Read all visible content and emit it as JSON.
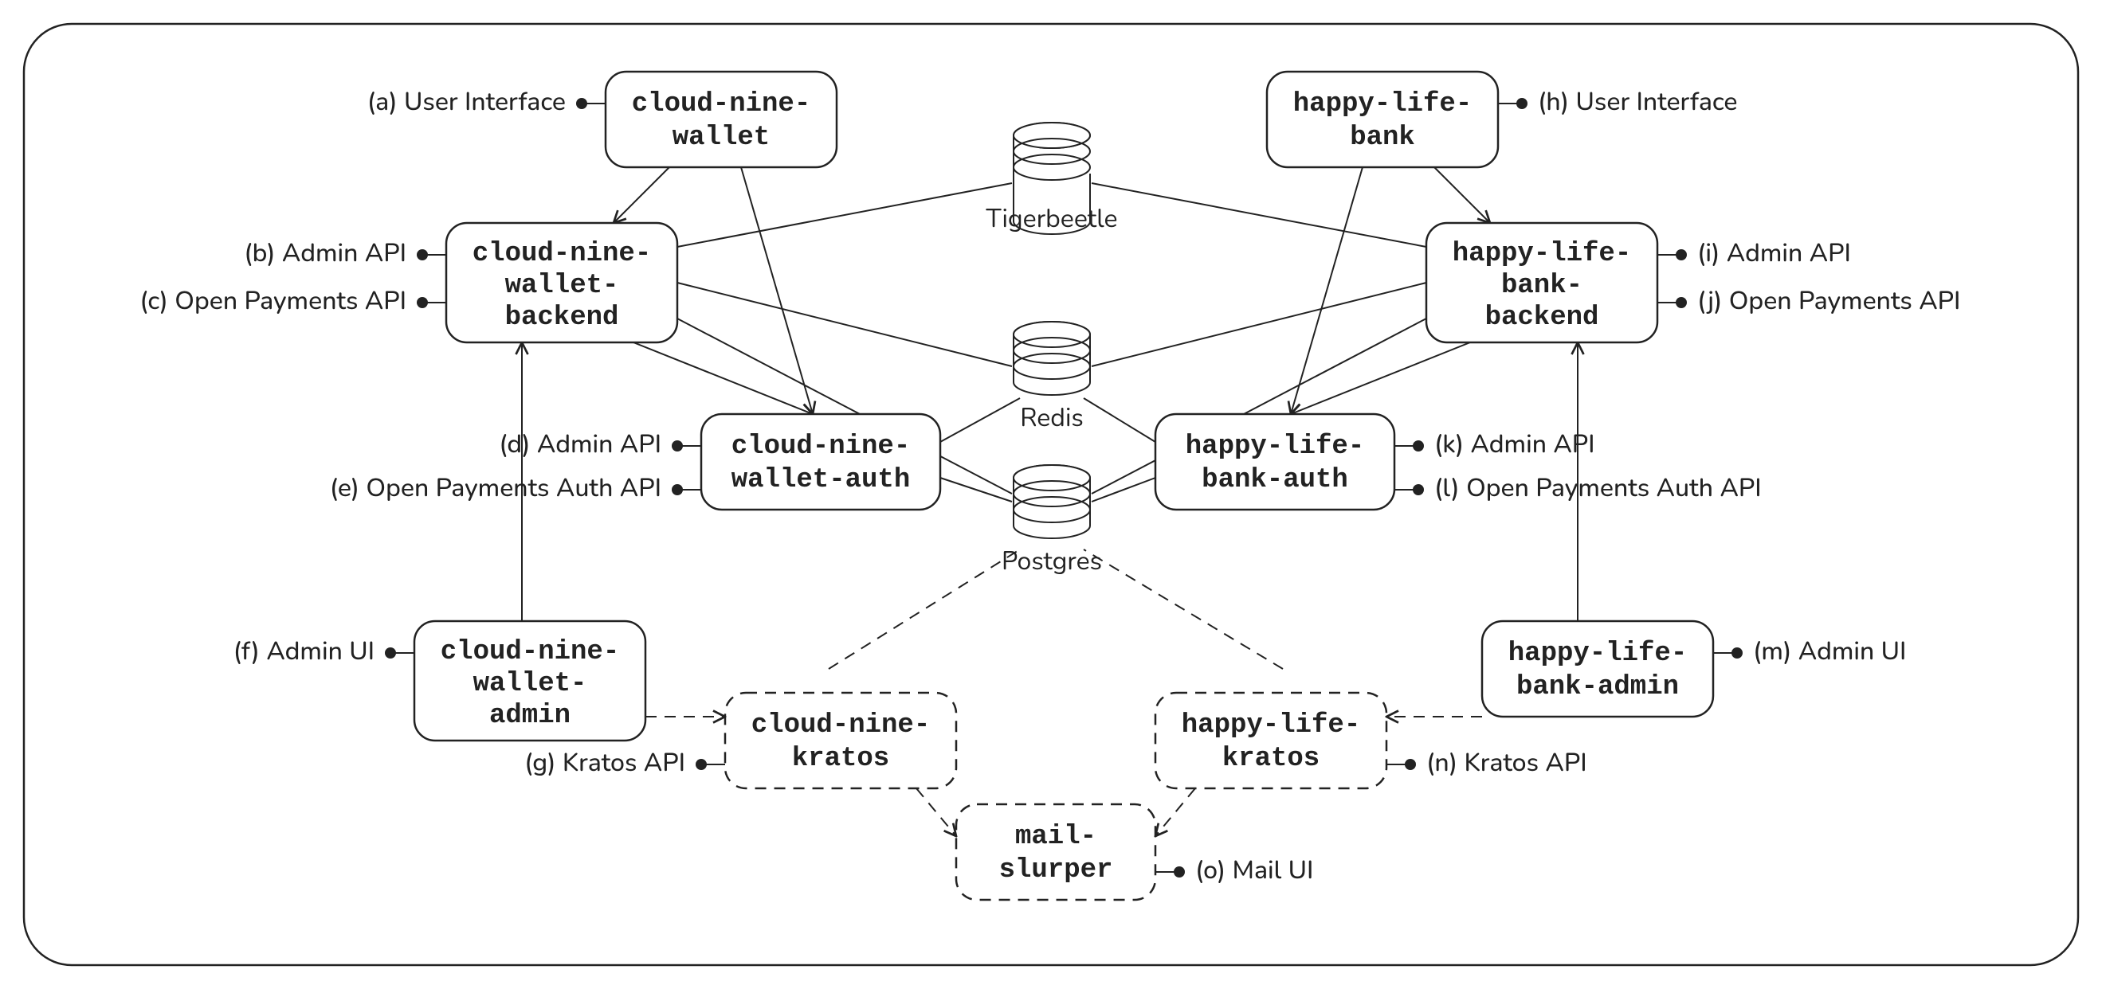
{
  "nodes": {
    "cn_wallet": {
      "line1": "cloud-nine-",
      "line2": "wallet"
    },
    "cn_backend": {
      "line1": "cloud-nine-",
      "line2": "wallet-",
      "line3": "backend"
    },
    "cn_auth": {
      "line1": "cloud-nine-",
      "line2": "wallet-auth"
    },
    "cn_admin": {
      "line1": "cloud-nine-",
      "line2": "wallet-",
      "line3": "admin"
    },
    "cn_kratos": {
      "line1": "cloud-nine-",
      "line2": "kratos"
    },
    "hl_bank": {
      "line1": "happy-life-",
      "line2": "bank"
    },
    "hl_backend": {
      "line1": "happy-life-",
      "line2": "bank-",
      "line3": "backend"
    },
    "hl_auth": {
      "line1": "happy-life-",
      "line2": "bank-auth"
    },
    "hl_admin": {
      "line1": "happy-life-",
      "line2": "bank-admin"
    },
    "hl_kratos": {
      "line1": "happy-life-",
      "line2": "kratos"
    },
    "mail": {
      "line1": "mail-",
      "line2": "slurper"
    }
  },
  "stores": {
    "tigerbeetle": "Tigerbeetle",
    "redis": "Redis",
    "postgres": "Postgres"
  },
  "annotations": {
    "a": "(a) User Interface",
    "b": "(b) Admin API",
    "c": "(c) Open Payments API",
    "d": "(d) Admin API",
    "e": "(e) Open Payments Auth API",
    "f": "(f) Admin UI",
    "g": "(g) Kratos API",
    "h": "(h) User Interface",
    "i": "(i) Admin API",
    "j": "(j) Open Payments API",
    "k": "(k) Admin API",
    "l": "(l) Open Payments Auth API",
    "m": "(m) Admin UI",
    "n": "(n) Kratos API",
    "o": "(o) Mail UI"
  }
}
